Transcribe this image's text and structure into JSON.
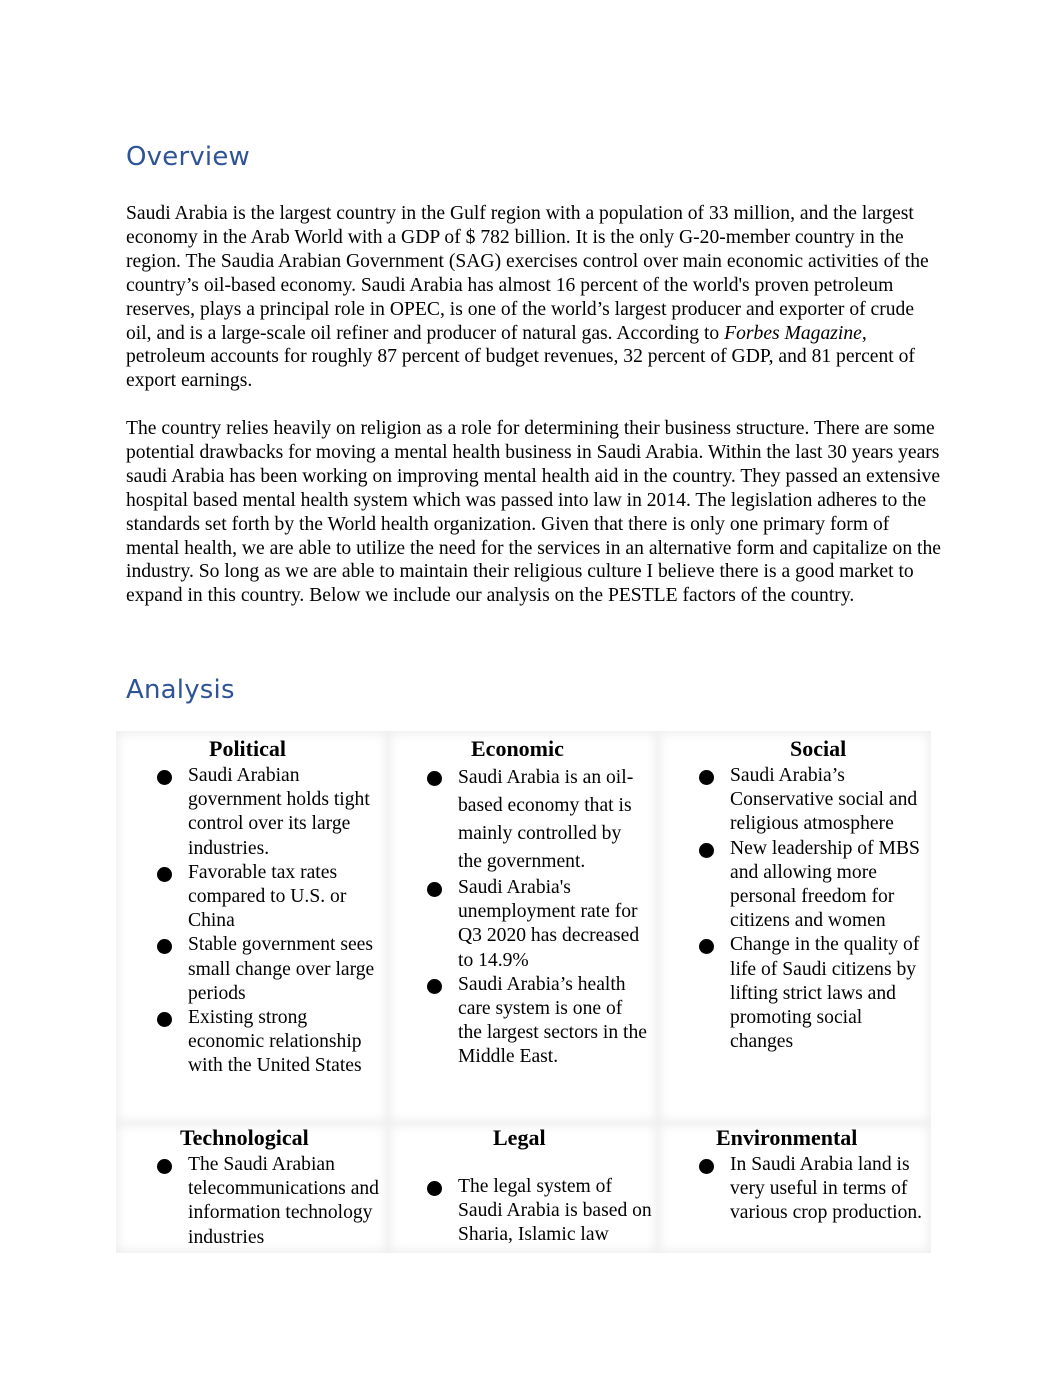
{
  "overview": {
    "heading": "Overview",
    "para1_part1": "Saudi Arabia is the largest country in the Gulf region with a population of 33 million, and the largest economy in the Arab World with a GDP of $ 782 billion.  It is the only G-20-member country in the region.  The Saudia Arabian Government (SAG) exercises control over main economic activities of the country’s oil-based economy.  Saudi Arabia has almost 16 percent of the world's proven petroleum reserves, plays a principal role in OPEC, is one of the world’s largest producer and exporter of crude oil, and is a large-scale oil refiner and producer of natural gas.  According to ",
    "para1_italic": "Forbes Magazine",
    "para1_part2": ", petroleum accounts for roughly 87 percent of budget revenues, 32 percent of GDP, and 81 percent of export earnings.",
    "para2": "The country relies heavily on religion as a role for determining their business structure. There are some potential drawbacks for moving a mental health business in Saudi Arabia. Within the last 30 years years saudi Arabia has been working on improving mental health aid in the country. They passed an extensive hospital based mental health system which was passed into law in 2014. The legislation adheres to the standards set forth by the World health organization. Given that there is only one primary form of mental health, we are able to utilize the need for the services in an alternative form and capitalize on the industry. So long as we are able to maintain their religious culture I believe there is a good market to expand in this country. Below we include our analysis on the PESTLE factors of the country."
  },
  "analysis": {
    "heading": "Analysis",
    "cells": [
      {
        "title": "Political",
        "items": [
          "Saudi Arabian government holds tight control over its large industries.",
          "Favorable tax rates compared to U.S. or China",
          "Stable government sees small change over large periods",
          "Existing strong economic relationship with the United States"
        ]
      },
      {
        "title": "Economic",
        "items": [
          "Saudi Arabia is an oil-based economy that is mainly controlled by the government.",
          "Saudi Arabia's unemployment rate for Q3 2020 has decreased to 14.9%",
          "Saudi Arabia’s health care system is one of the largest sectors in the Middle East."
        ]
      },
      {
        "title": "Social",
        "items": [
          "Saudi Arabia’s Conservative social and religious atmosphere",
          "New leadership of MBS and allowing more personal freedom for citizens and women",
          "Change in the quality of life of Saudi citizens by lifting strict laws and promoting social changes"
        ]
      },
      {
        "title": "Technological",
        "items": [
          "The Saudi Arabian telecommunications and information technology industries"
        ]
      },
      {
        "title": "Legal",
        "items": [
          "The legal system of Saudi Arabia is based on Sharia, Islamic law"
        ]
      },
      {
        "title": "Environmental",
        "items": [
          "In Saudi Arabia land is very useful in terms of various crop production."
        ]
      }
    ]
  }
}
